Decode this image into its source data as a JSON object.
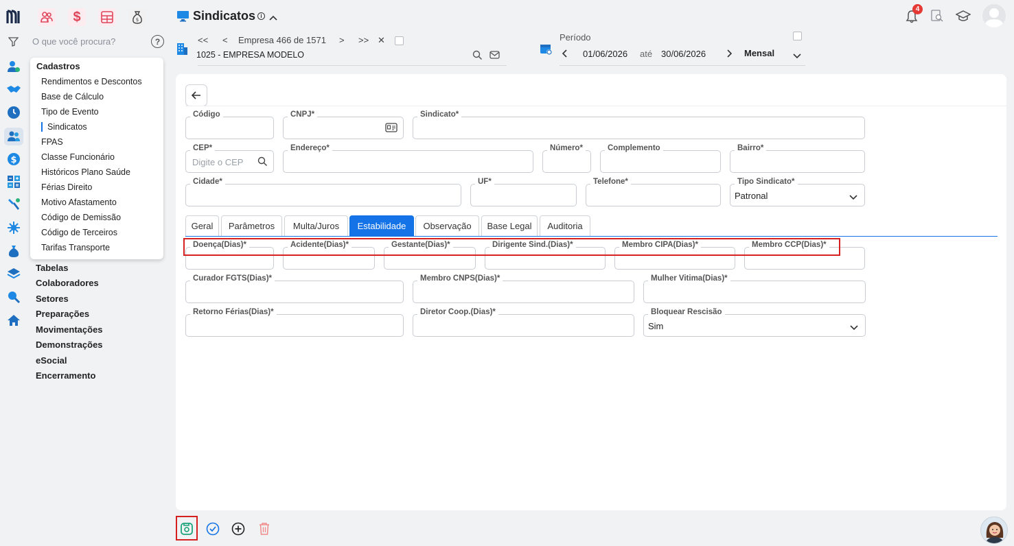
{
  "search": {
    "placeholder": "O que você procura?"
  },
  "menu": {
    "header": "Cadastros",
    "items": [
      "Rendimentos e Descontos",
      "Base de Cálculo",
      "Tipo de Evento",
      "Sindicatos",
      "FPAS",
      "Classe Funcionário",
      "Históricos Plano Saúde",
      "Férias Direito",
      "Motivo Afastamento",
      "Código de Demissão",
      "Código de Terceiros",
      "Tarifas Transporte"
    ],
    "active": "Sindicatos"
  },
  "nav_groups": [
    "Tabelas",
    "Colaboradores",
    "Setores",
    "Preparações",
    "Movimentações",
    "Demonstrações",
    "eSocial",
    "Encerramento"
  ],
  "header": {
    "title": "Sindicatos",
    "company_nav": {
      "first": "<<",
      "prev": "<",
      "text": "Empresa 466 de 1571",
      "next": ">",
      "last": ">>",
      "close": "✕"
    },
    "company_name": "1025 - EMPRESA MODELO",
    "period": {
      "label": "Período",
      "start": "01/06/2026",
      "sep": "até",
      "end": "30/06/2026",
      "mode": "Mensal"
    },
    "notifications_count": "4"
  },
  "form": {
    "codigo": {
      "label": "Código",
      "value": ""
    },
    "cnpj": {
      "label": "CNPJ*",
      "value": ""
    },
    "sindicato": {
      "label": "Sindicato*",
      "value": ""
    },
    "cep": {
      "label": "CEP*",
      "placeholder": "Digite o CEP"
    },
    "endereco": {
      "label": "Endereço*"
    },
    "numero": {
      "label": "Número*"
    },
    "complemento": {
      "label": "Complemento"
    },
    "bairro": {
      "label": "Bairro*"
    },
    "cidade": {
      "label": "Cidade*"
    },
    "uf": {
      "label": "UF*"
    },
    "telefone": {
      "label": "Telefone*"
    },
    "tipo_sindicato": {
      "label": "Tipo Sindicato*",
      "value": "Patronal"
    }
  },
  "tabs": [
    "Geral",
    "Parâmetros",
    "Multa/Juros",
    "Estabilidade",
    "Observação",
    "Base Legal",
    "Auditoria"
  ],
  "active_tab": "Estabilidade",
  "estabilidade": {
    "doenca": "Doença(Dias)*",
    "acidente": "Acidente(Dias)*",
    "gestante": "Gestante(Dias)*",
    "dirigente": "Dirigente Sind.(Dias)*",
    "membro_cipa": "Membro CIPA(Dias)*",
    "membro_ccp": "Membro CCP(Dias)*",
    "curador": "Curador FGTS(Dias)*",
    "membro_cnps": "Membro CNPS(Dias)*",
    "mulher_vitima": "Mulher Vitima(Dias)*",
    "retorno_ferias": "Retorno Férias(Dias)*",
    "diretor_coop": "Diretor Coop.(Dias)*",
    "bloquear_rescisao": {
      "label": "Bloquear Rescisão",
      "value": "Sim"
    }
  },
  "colors": {
    "accent": "#1473e6",
    "highlight": "#d61f1f",
    "save": "#1aa37a",
    "delete": "#f08a8a"
  }
}
